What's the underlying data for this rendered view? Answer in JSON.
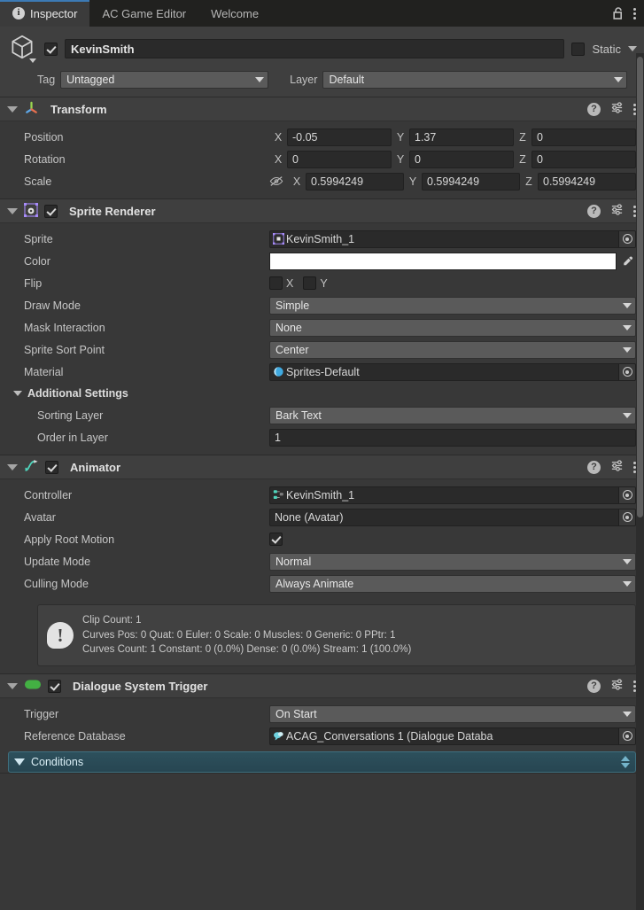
{
  "tabs": [
    {
      "label": "Inspector",
      "icon": "info-icon",
      "active": true
    },
    {
      "label": "AC Game Editor",
      "active": false
    },
    {
      "label": "Welcome",
      "active": false
    }
  ],
  "window_tools": {
    "lock": "lock-open-icon",
    "menu": "kebab-menu-icon"
  },
  "gameobject": {
    "enabled": true,
    "name": "KevinSmith",
    "static_label": "Static",
    "static_checked": false,
    "tag_label": "Tag",
    "tag_value": "Untagged",
    "layer_label": "Layer",
    "layer_value": "Default"
  },
  "components": [
    {
      "id": "transform",
      "title": "Transform",
      "icon": "transform-axis-icon",
      "has_enable_toggle": false,
      "rows": [
        {
          "label": "Position",
          "type": "vector3",
          "x": "-0.05",
          "y": "1.37",
          "z": "0"
        },
        {
          "label": "Rotation",
          "type": "vector3",
          "x": "0",
          "y": "0",
          "z": "0"
        },
        {
          "label": "Scale",
          "type": "vector3",
          "x": "0.5994249",
          "y": "0.5994249",
          "z": "0.5994249",
          "lock_icon": "constrain-proportions-off-icon"
        }
      ]
    },
    {
      "id": "sprite-renderer",
      "title": "Sprite Renderer",
      "icon": "sprite-renderer-icon",
      "has_enable_toggle": true,
      "enabled": true,
      "rows": [
        {
          "label": "Sprite",
          "type": "object",
          "value": "KevinSmith_1",
          "icon": "sprite-asset-icon"
        },
        {
          "label": "Color",
          "type": "color",
          "value": "#FFFFFF"
        },
        {
          "label": "Flip",
          "type": "flip",
          "x_label": "X",
          "y_label": "Y",
          "x_checked": false,
          "y_checked": false
        },
        {
          "label": "Draw Mode",
          "type": "popup",
          "value": "Simple"
        },
        {
          "label": "Mask Interaction",
          "type": "popup",
          "value": "None"
        },
        {
          "label": "Sprite Sort Point",
          "type": "popup",
          "value": "Center"
        },
        {
          "label": "Material",
          "type": "object",
          "value": "Sprites-Default",
          "icon": "material-sphere-icon"
        },
        {
          "label": "Additional Settings",
          "type": "subfoldout"
        },
        {
          "label": "Sorting Layer",
          "type": "popup",
          "value": "Bark Text",
          "indent": 2
        },
        {
          "label": "Order in Layer",
          "type": "number",
          "value": "1",
          "indent": 2
        }
      ]
    },
    {
      "id": "animator",
      "title": "Animator",
      "icon": "animator-icon",
      "has_enable_toggle": true,
      "enabled": true,
      "rows": [
        {
          "label": "Controller",
          "type": "object",
          "value": "KevinSmith_1",
          "icon": "animator-controller-icon"
        },
        {
          "label": "Avatar",
          "type": "object",
          "value": "None (Avatar)",
          "icon": "none-icon"
        },
        {
          "label": "Apply Root Motion",
          "type": "checkbox",
          "checked": true
        },
        {
          "label": "Update Mode",
          "type": "popup",
          "value": "Normal"
        },
        {
          "label": "Culling Mode",
          "type": "popup",
          "value": "Always Animate"
        }
      ],
      "infobox": {
        "icon": "warning-exclamation-icon",
        "lines": [
          "Clip Count: 1",
          "Curves Pos: 0 Quat: 0 Euler: 0 Scale: 0 Muscles: 0 Generic: 0 PPtr: 1",
          "Curves Count: 1 Constant: 0 (0.0%) Dense: 0 (0.0%) Stream: 1 (100.0%)"
        ]
      }
    },
    {
      "id": "dialogue-system-trigger",
      "title": "Dialogue System Trigger",
      "icon": "script-icon",
      "has_enable_toggle": true,
      "enabled": true,
      "rows": [
        {
          "label": "Trigger",
          "type": "popup",
          "value": "On Start"
        },
        {
          "label": "Reference Database",
          "type": "object",
          "value": "ACAG_Conversations 1 (Dialogue Databa",
          "icon": "dialogue-database-icon"
        }
      ],
      "conditions": {
        "label": "Conditions",
        "expanded": true
      }
    }
  ],
  "colors": {
    "accent_tab": "#3c7ab5",
    "panel_bg": "#383838",
    "header_bg": "#3f3f3f",
    "field_bg": "#2a2a2a",
    "popup_bg": "#5a5a5a",
    "conditions_bg": "#2d505c",
    "sprite_icon": "#a78bfa",
    "material_icon": "#4db8e8",
    "animator_icon": "#4fd6bd",
    "script_icon": "#4bb74b"
  }
}
